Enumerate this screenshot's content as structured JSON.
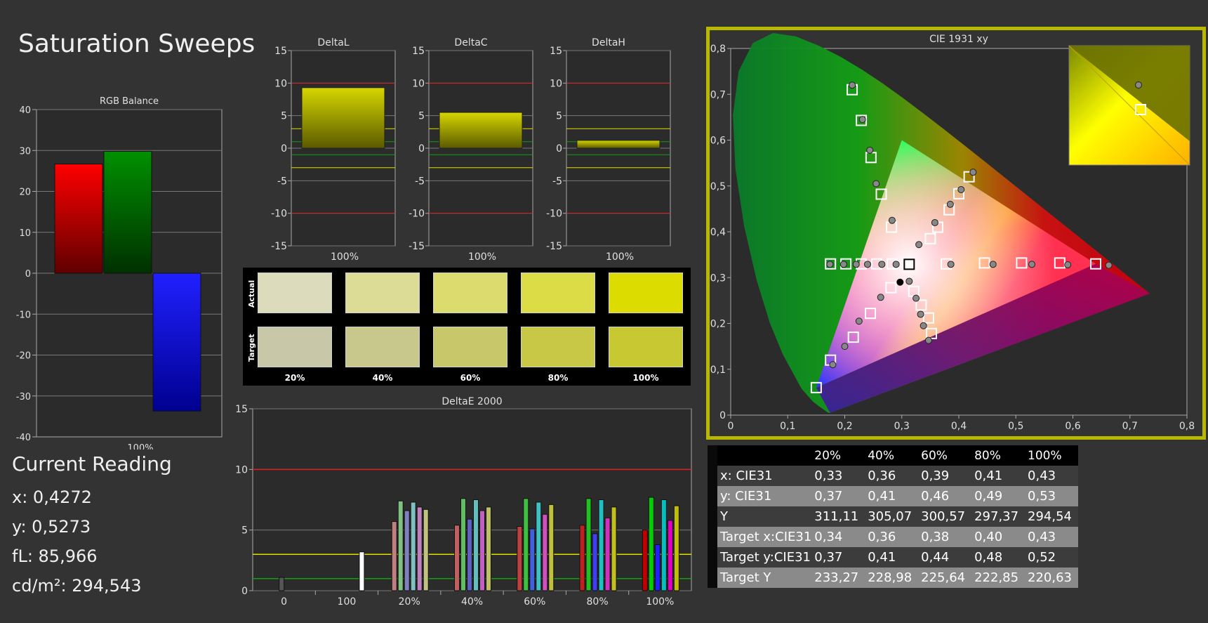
{
  "page_title": "Saturation Sweeps",
  "current_reading": {
    "title": "Current Reading",
    "x": "x: 0,4272",
    "y": "y: 0,5273",
    "fl": "fL: 85,966",
    "cdm2": "cd/m²: 294,543"
  },
  "colors": {
    "yellow_bar": "#c8c800",
    "red": "#ff0000",
    "green": "#00a000",
    "blue": "#0000ff",
    "frame": "#b8b800"
  },
  "chart_data": [
    {
      "id": "rgb_balance",
      "type": "bar",
      "title": "RGB Balance",
      "categories": [
        "100%"
      ],
      "series": [
        {
          "color": "red",
          "values": [
            26.7
          ]
        },
        {
          "color": "green",
          "values": [
            29.8
          ]
        },
        {
          "color": "blue",
          "values": [
            -33.7
          ]
        }
      ],
      "ylim": [
        -40,
        40
      ],
      "yticks": [
        "40",
        "30",
        "20",
        "10",
        "0",
        "-10",
        "-20",
        "-30",
        "-40"
      ]
    },
    {
      "id": "delta_l",
      "type": "bar",
      "title": "DeltaL",
      "categories": [
        "100%"
      ],
      "values": [
        9.3
      ],
      "ylim": [
        -15,
        15
      ],
      "yticks": [
        "15",
        "10",
        "5",
        "0",
        "-5",
        "-10",
        "-15"
      ]
    },
    {
      "id": "delta_c",
      "type": "bar",
      "title": "DeltaC",
      "categories": [
        "100%"
      ],
      "values": [
        5.5
      ],
      "ylim": [
        -15,
        15
      ],
      "yticks": [
        "15",
        "10",
        "5",
        "0",
        "-5",
        "-10",
        "-15"
      ]
    },
    {
      "id": "delta_h",
      "type": "bar",
      "title": "DeltaH",
      "categories": [
        "100%"
      ],
      "values": [
        1.2
      ],
      "ylim": [
        -15,
        15
      ],
      "yticks": [
        "15",
        "10",
        "5",
        "0",
        "-5",
        "-10",
        "-15"
      ]
    },
    {
      "id": "delta_e_2000",
      "type": "bar",
      "title": "DeltaE 2000",
      "categories": [
        "0",
        "100",
        "20%",
        "40%",
        "60%",
        "80%",
        "100%"
      ],
      "groups": [
        {
          "category": "0",
          "values": [
            1.1
          ],
          "colors": [
            "#555555"
          ]
        },
        {
          "category": "100",
          "values": [
            3.2
          ],
          "colors": [
            "#ffffff"
          ]
        },
        {
          "category": "20%",
          "values": [
            5.7,
            7.4,
            6.6,
            7.3,
            6.9,
            6.7
          ],
          "colors": [
            "#c08080",
            "#80c080",
            "#8080c0",
            "#80c0c0",
            "#c080c0",
            "#c0c080"
          ]
        },
        {
          "category": "40%",
          "values": [
            5.4,
            7.6,
            5.9,
            7.5,
            6.6,
            6.9
          ],
          "colors": [
            "#c06060",
            "#60c060",
            "#6060c0",
            "#60c0c0",
            "#c060c0",
            "#c0c060"
          ]
        },
        {
          "category": "60%",
          "values": [
            5.3,
            7.6,
            5.1,
            7.3,
            6.3,
            7.1
          ],
          "colors": [
            "#c04040",
            "#40c040",
            "#4060e0",
            "#40c0c0",
            "#d050c0",
            "#c0c040"
          ]
        },
        {
          "category": "80%",
          "values": [
            5.4,
            7.6,
            4.7,
            7.5,
            6.0,
            6.9
          ],
          "colors": [
            "#c02020",
            "#20c020",
            "#4040f0",
            "#20c0c0",
            "#d030c0",
            "#c0c020"
          ]
        },
        {
          "category": "100%",
          "values": [
            5.0,
            7.7,
            3.8,
            7.5,
            5.8,
            7.0
          ],
          "colors": [
            "#c00000",
            "#00d000",
            "#2020ff",
            "#00c0c0",
            "#e000c0",
            "#c0c000"
          ]
        }
      ],
      "ylim": [
        0,
        15
      ],
      "yticks": [
        "15",
        "10",
        "5",
        "0"
      ]
    },
    {
      "id": "cie_1931_xy",
      "type": "scatter",
      "title": "CIE 1931 xy",
      "xlim": [
        0,
        0.8
      ],
      "ylim": [
        0,
        0.8
      ],
      "xticks": [
        "0",
        "0,1",
        "0,2",
        "0,3",
        "0,4",
        "0,5",
        "0,6",
        "0,7",
        "0,8"
      ],
      "yticks": [
        "0",
        "0,1",
        "0,2",
        "0,3",
        "0,4",
        "0,5",
        "0,6",
        "0,7",
        "0,8"
      ],
      "gamut": [
        [
          0.64,
          0.33
        ],
        [
          0.3,
          0.6
        ],
        [
          0.15,
          0.06
        ]
      ],
      "targets": [
        [
          0.213,
          0.71
        ],
        [
          0.229,
          0.643
        ],
        [
          0.246,
          0.562
        ],
        [
          0.264,
          0.482
        ],
        [
          0.282,
          0.41
        ],
        [
          0.175,
          0.33
        ],
        [
          0.202,
          0.33
        ],
        [
          0.229,
          0.33
        ],
        [
          0.256,
          0.33
        ],
        [
          0.283,
          0.33
        ],
        [
          0.313,
          0.329
        ],
        [
          0.378,
          0.33
        ],
        [
          0.445,
          0.332
        ],
        [
          0.51,
          0.332
        ],
        [
          0.577,
          0.332
        ],
        [
          0.64,
          0.33
        ],
        [
          0.175,
          0.12
        ],
        [
          0.215,
          0.17
        ],
        [
          0.245,
          0.222
        ],
        [
          0.281,
          0.278
        ],
        [
          0.321,
          0.27
        ],
        [
          0.334,
          0.24
        ],
        [
          0.347,
          0.212
        ],
        [
          0.352,
          0.178
        ],
        [
          0.15,
          0.06
        ],
        [
          0.35,
          0.385
        ],
        [
          0.363,
          0.41
        ],
        [
          0.383,
          0.448
        ],
        [
          0.4,
          0.483
        ],
        [
          0.418,
          0.52
        ]
      ],
      "actuals": [
        [
          0.213,
          0.72
        ],
        [
          0.231,
          0.645
        ],
        [
          0.244,
          0.578
        ],
        [
          0.255,
          0.505
        ],
        [
          0.283,
          0.425
        ],
        [
          0.174,
          0.329
        ],
        [
          0.198,
          0.329
        ],
        [
          0.22,
          0.329
        ],
        [
          0.24,
          0.329
        ],
        [
          0.265,
          0.329
        ],
        [
          0.29,
          0.329
        ],
        [
          0.386,
          0.329
        ],
        [
          0.46,
          0.329
        ],
        [
          0.528,
          0.329
        ],
        [
          0.591,
          0.328
        ],
        [
          0.663,
          0.327
        ],
        [
          0.179,
          0.11
        ],
        [
          0.2,
          0.15
        ],
        [
          0.225,
          0.205
        ],
        [
          0.263,
          0.257
        ],
        [
          0.313,
          0.292
        ],
        [
          0.325,
          0.255
        ],
        [
          0.333,
          0.22
        ],
        [
          0.338,
          0.195
        ],
        [
          0.347,
          0.163
        ],
        [
          0.33,
          0.372
        ],
        [
          0.358,
          0.42
        ],
        [
          0.385,
          0.46
        ],
        [
          0.404,
          0.492
        ],
        [
          0.425,
          0.53
        ]
      ],
      "white_target": [
        0.313,
        0.329
      ],
      "white_actual": [
        0.297,
        0.29
      ],
      "current": [
        0.4272,
        0.5273
      ]
    }
  ],
  "swatches": {
    "row_labels": [
      "Actual",
      "Target"
    ],
    "labels": [
      "20%",
      "40%",
      "60%",
      "80%",
      "100%"
    ],
    "actual": [
      "#dcdcbc",
      "#dcdc96",
      "#dcdc6e",
      "#dcdc46",
      "#dcdc00"
    ],
    "target": [
      "#c8c8a8",
      "#c8c88c",
      "#c8c86a",
      "#c8c846",
      "#c8c832"
    ]
  },
  "table": {
    "headers": [
      "",
      "20%",
      "40%",
      "60%",
      "80%",
      "100%"
    ],
    "rows": [
      {
        "label": "x: CIE31",
        "values": [
          "0,33",
          "0,36",
          "0,39",
          "0,41",
          "0,43"
        ]
      },
      {
        "label": "y: CIE31",
        "values": [
          "0,37",
          "0,41",
          "0,46",
          "0,49",
          "0,53"
        ]
      },
      {
        "label": "Y",
        "values": [
          "311,11",
          "305,07",
          "300,57",
          "297,37",
          "294,54"
        ]
      },
      {
        "label": "Target x:CIE31",
        "values": [
          "0,34",
          "0,36",
          "0,38",
          "0,40",
          "0,43"
        ]
      },
      {
        "label": "Target y:CIE31",
        "values": [
          "0,37",
          "0,41",
          "0,44",
          "0,48",
          "0,52"
        ]
      },
      {
        "label": "Target Y",
        "values": [
          "233,27",
          "228,98",
          "225,64",
          "222,85",
          "220,63"
        ]
      }
    ]
  }
}
